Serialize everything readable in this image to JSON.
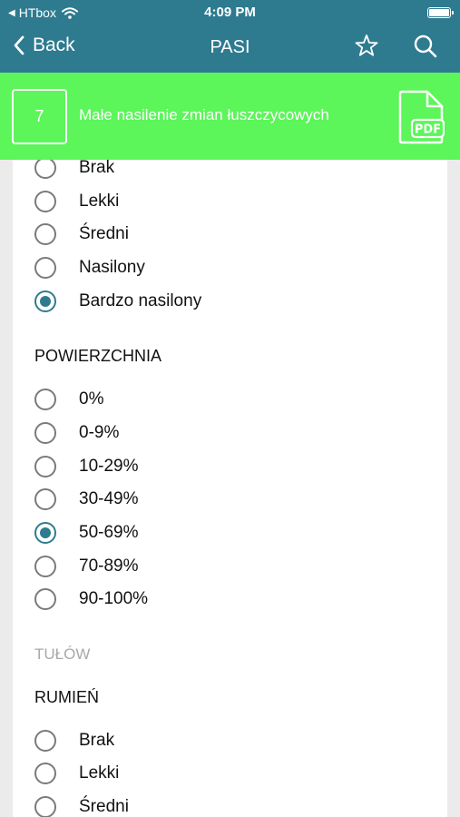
{
  "status_bar": {
    "carrier": "HTbox",
    "time": "4:09 PM"
  },
  "nav": {
    "back_label": "Back",
    "title": "PASI"
  },
  "banner": {
    "score": "7",
    "text": "Małe nasilenie zmian łuszczycowych",
    "pdf_label": "PDF"
  },
  "colors": {
    "header": "#2e7b90",
    "banner": "#5cf55a",
    "accent": "#2e7b90"
  },
  "group1": {
    "options": [
      "Brak",
      "Lekki",
      "Średni",
      "Nasilony",
      "Bardzo nasilony"
    ],
    "selected": "Bardzo nasilony"
  },
  "group2": {
    "heading": "POWIERZCHNIA",
    "options": [
      "0%",
      "0-9%",
      "10-29%",
      "30-49%",
      "50-69%",
      "70-89%",
      "90-100%"
    ],
    "selected": "50-69%"
  },
  "section": {
    "label": "TUŁÓW"
  },
  "group3": {
    "heading": "RUMIEŃ",
    "options": [
      "Brak",
      "Lekki",
      "Średni"
    ],
    "selected": null
  }
}
